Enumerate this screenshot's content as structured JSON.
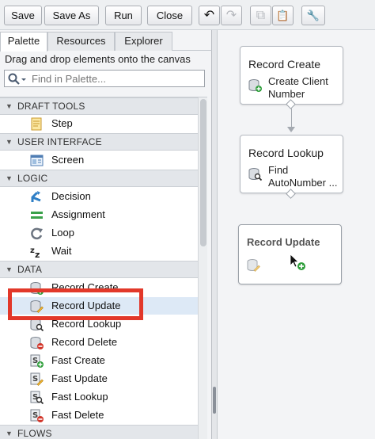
{
  "toolbar": {
    "save": "Save",
    "save_as": "Save As",
    "run": "Run",
    "close": "Close",
    "undo_icon": "↶",
    "redo_icon": "↷",
    "copy_icon": "⧉",
    "paste_icon": "📋",
    "settings_icon": "🔧"
  },
  "tabs": {
    "palette": "Palette",
    "resources": "Resources",
    "explorer": "Explorer"
  },
  "palette": {
    "hint": "Drag and drop elements onto the canvas",
    "search_placeholder": "Find in Palette...",
    "sections": {
      "draft_tools": "DRAFT TOOLS",
      "user_interface": "USER INTERFACE",
      "logic": "LOGIC",
      "data": "DATA",
      "flows": "FLOWS"
    },
    "items": {
      "step": "Step",
      "screen": "Screen",
      "decision": "Decision",
      "assignment": "Assignment",
      "loop": "Loop",
      "wait": "Wait",
      "record_create": "Record Create",
      "record_update": "Record Update",
      "record_lookup": "Record Lookup",
      "record_delete": "Record Delete",
      "fast_create": "Fast Create",
      "fast_update": "Fast Update",
      "fast_lookup": "Fast Lookup",
      "fast_delete": "Fast Delete"
    }
  },
  "canvas": {
    "node1": {
      "title": "Record Create",
      "sub": "Create Client Number"
    },
    "node2": {
      "title": "Record Lookup",
      "sub": "Find AutoNumber ..."
    },
    "ghost": {
      "title": "Record Update"
    }
  },
  "colors": {
    "highlight": "#e2382a",
    "selected_row": "#dde9f6",
    "accent_green": "#2e9e3a"
  }
}
